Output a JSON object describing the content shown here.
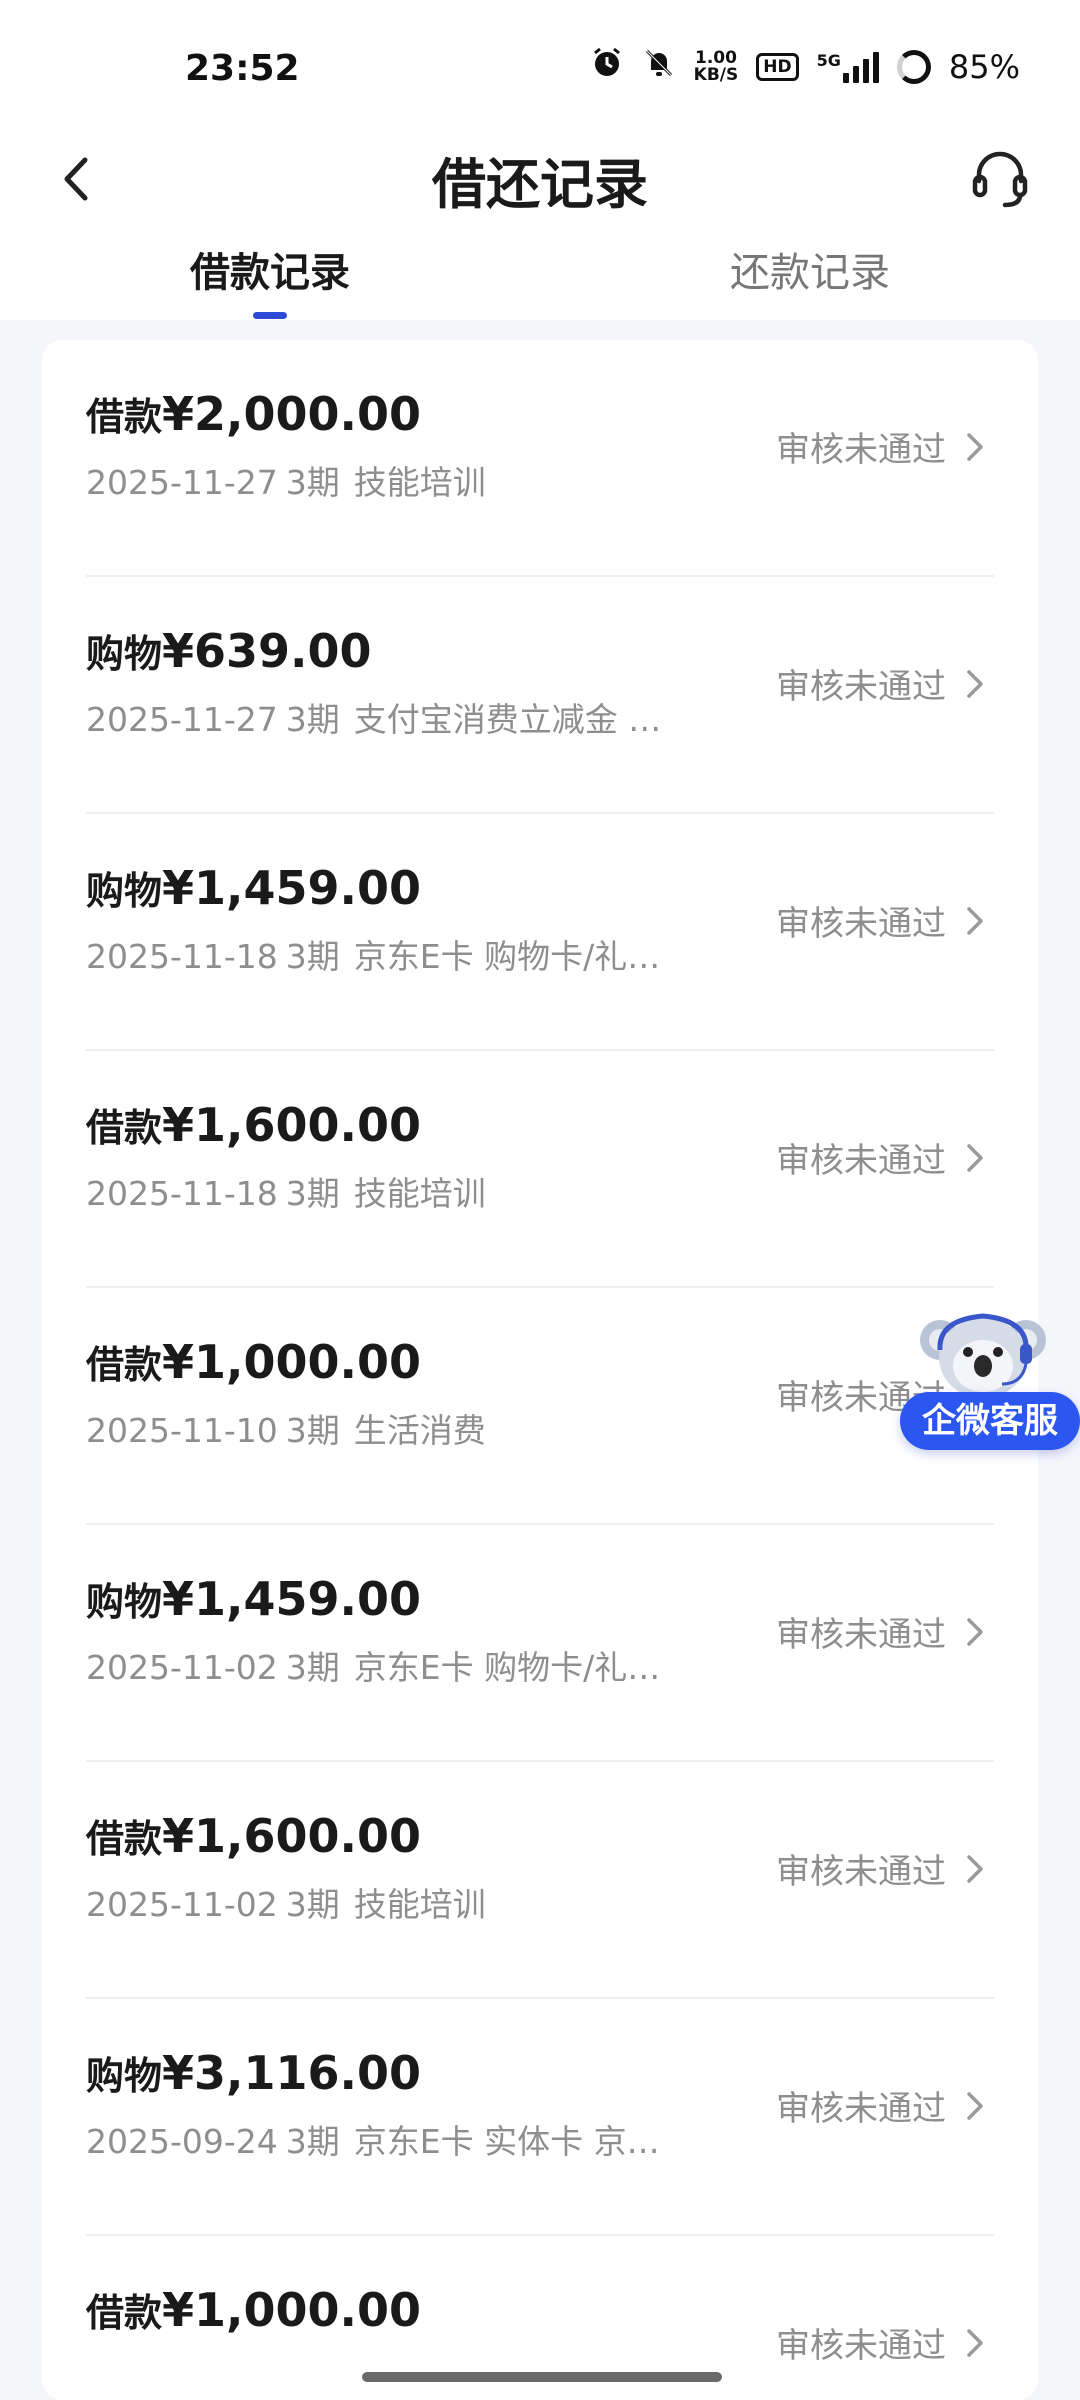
{
  "status_bar": {
    "time": "23:52",
    "speed_value": "1.00",
    "speed_unit": "KB/S",
    "hd": "HD",
    "network": "5G",
    "battery": "85%"
  },
  "header": {
    "title": "借还记录",
    "back_icon": "chevron-left-icon",
    "service_icon": "headset-icon"
  },
  "tabs": [
    {
      "label": "借款记录",
      "active": true
    },
    {
      "label": "还款记录",
      "active": false
    }
  ],
  "records": [
    {
      "type": "借款",
      "amount": "¥2,000.00",
      "date": "2025-11-27",
      "periods": "3期",
      "desc": "技能培训",
      "status": "审核未通过"
    },
    {
      "type": "购物",
      "amount": "¥639.00",
      "date": "2025-11-27",
      "periods": "3期",
      "desc": "支付宝消费立减金 消...",
      "status": "审核未通过"
    },
    {
      "type": "购物",
      "amount": "¥1,459.00",
      "date": "2025-11-18",
      "periods": "3期",
      "desc": "京东E卡 购物卡/礼品...",
      "status": "审核未通过"
    },
    {
      "type": "借款",
      "amount": "¥1,600.00",
      "date": "2025-11-18",
      "periods": "3期",
      "desc": "技能培训",
      "status": "审核未通过"
    },
    {
      "type": "借款",
      "amount": "¥1,000.00",
      "date": "2025-11-10",
      "periods": "3期",
      "desc": "生活消费",
      "status": "审核未通过"
    },
    {
      "type": "购物",
      "amount": "¥1,459.00",
      "date": "2025-11-02",
      "periods": "3期",
      "desc": "京东E卡 购物卡/礼品...",
      "status": "审核未通过"
    },
    {
      "type": "借款",
      "amount": "¥1,600.00",
      "date": "2025-11-02",
      "periods": "3期",
      "desc": "技能培训",
      "status": "审核未通过"
    },
    {
      "type": "购物",
      "amount": "¥3,116.00",
      "date": "2025-09-24",
      "periods": "3期",
      "desc": "京东E卡 实体卡 京东...",
      "status": "审核未通过"
    },
    {
      "type": "借款",
      "amount": "¥1,000.00",
      "date": "",
      "periods": "",
      "desc": "",
      "status": "审核未通过"
    }
  ],
  "float_service": {
    "label": "企微客服",
    "icon": "koala-mascot-icon"
  },
  "colors": {
    "accent": "#2d4bd8",
    "float_button": "#2c56f0",
    "muted_text": "#8e8e8e",
    "background": "#f5f6fa"
  }
}
